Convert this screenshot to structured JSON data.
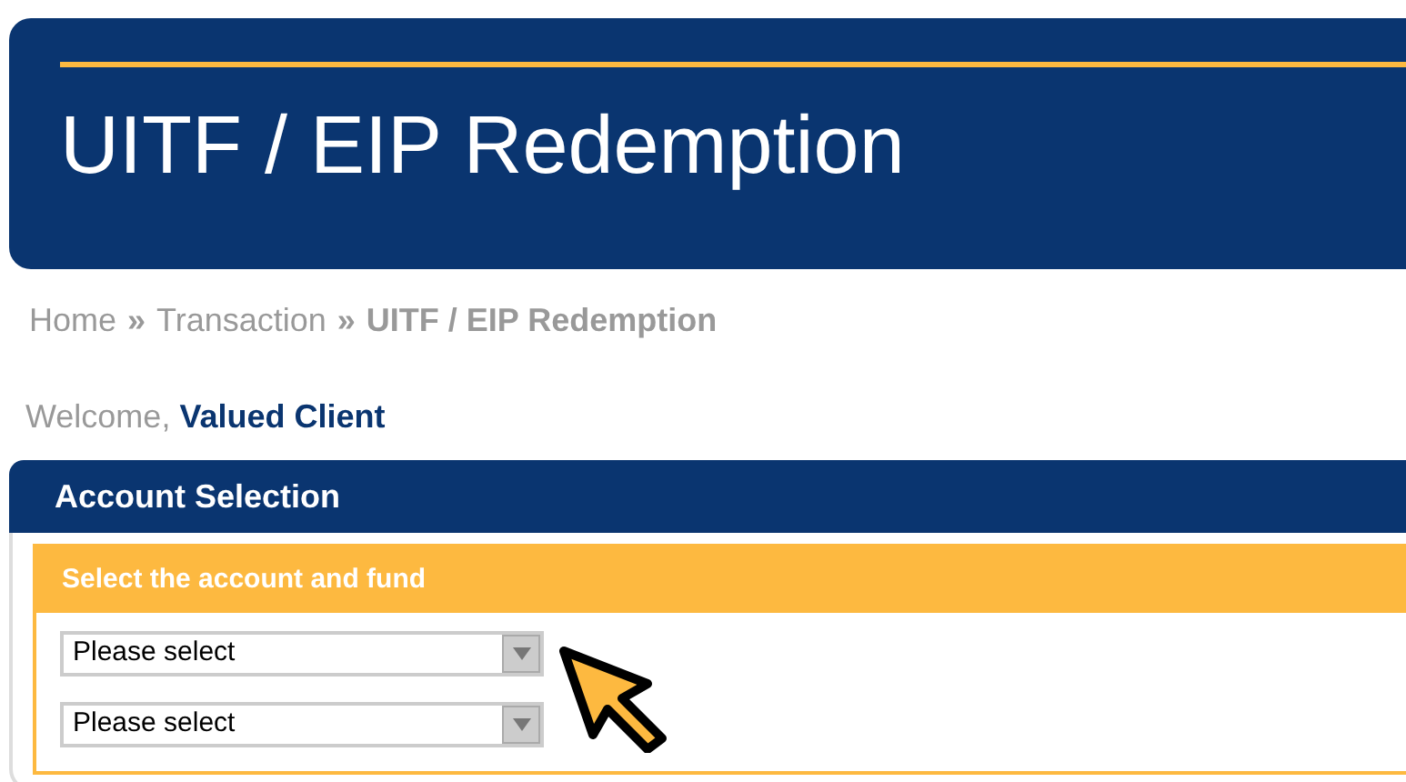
{
  "header": {
    "title": "UITF / EIP Redemption"
  },
  "breadcrumb": [
    {
      "kind": "link",
      "label": "Home"
    },
    {
      "kind": "separator",
      "label": "»"
    },
    {
      "kind": "link",
      "label": "Transaction"
    },
    {
      "kind": "separator",
      "label": "»"
    },
    {
      "kind": "current",
      "label": "UITF / EIP Redemption"
    }
  ],
  "welcome": "Welcome, **Valued Client**",
  "panel": {
    "title": "Account Selection",
    "section": {
      "title": "Select the account and fund",
      "selects": [
        {
          "placeholder": "Please select"
        },
        {
          "placeholder": "Please select"
        }
      ]
    }
  }
}
